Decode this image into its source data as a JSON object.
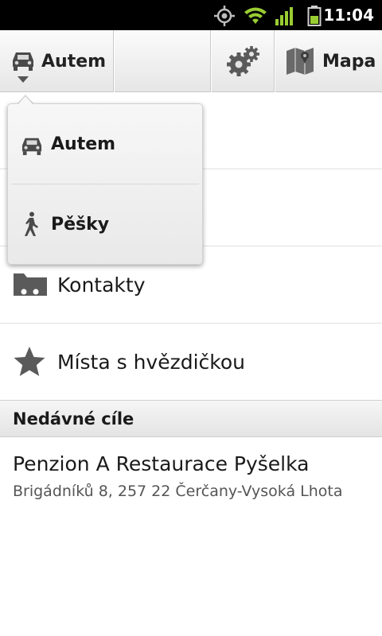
{
  "status_bar": {
    "time": "11:04",
    "icons": [
      "gps-icon",
      "wifi-icon",
      "signal-icon",
      "battery-icon"
    ]
  },
  "action_bar": {
    "mode_label": "Autem",
    "settings_icon": "gears-icon",
    "map_label": "Mapa"
  },
  "dropdown": {
    "items": [
      {
        "label": "Autem",
        "icon": "car-icon"
      },
      {
        "label": "Pěšky",
        "icon": "walking-icon"
      }
    ]
  },
  "list": {
    "items": [
      {
        "label": "Kontakty",
        "icon": "contacts-folder-icon"
      },
      {
        "label": "Místa s hvězdičkou",
        "icon": "star-icon"
      }
    ]
  },
  "recent": {
    "header": "Nedávné cíle",
    "items": [
      {
        "title": "Penzion A Restaurace Pyšelka",
        "address": "Brigádníků 8, 257 22 Čerčany-Vysoká Lhota"
      }
    ]
  },
  "colors": {
    "status_bar_bg": "#000000",
    "wifi": "#9acd32",
    "battery": "#9acd32",
    "icon_gray": "#555555"
  }
}
